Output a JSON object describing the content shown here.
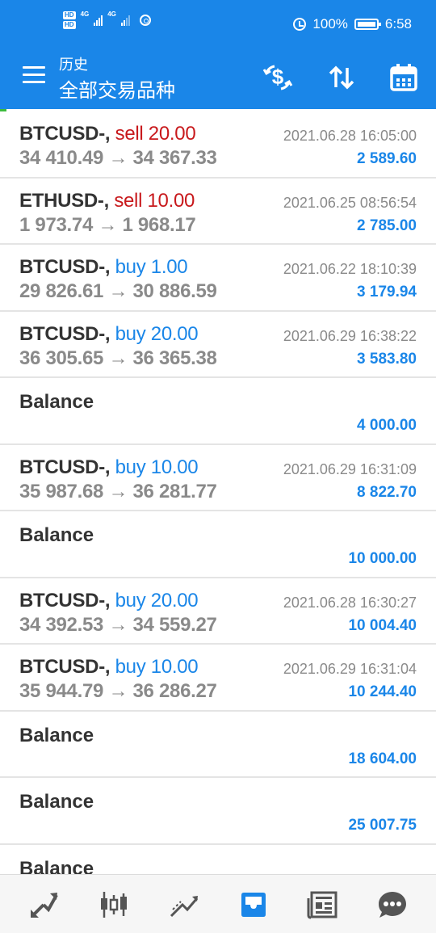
{
  "status_bar": {
    "hd1": "HD",
    "hd2": "HD",
    "sig1_label": "4G",
    "sig2_label": "4G",
    "battery_pct": "100%",
    "time": "6:58"
  },
  "app_bar": {
    "title": "历史",
    "subtitle": "全部交易品种",
    "icons": [
      "menu-icon",
      "dollar-swap-icon",
      "sort-icon",
      "calendar-icon"
    ]
  },
  "entries": [
    {
      "type": "trade",
      "symbol": "BTCUSD-,",
      "side": "sell",
      "volume": "20.00",
      "open": "34 410.49",
      "close": "34 367.33",
      "datetime": "2021.06.28 16:05:00",
      "profit": "2 589.60"
    },
    {
      "type": "trade",
      "symbol": "ETHUSD-,",
      "side": "sell",
      "volume": "10.00",
      "open": "1 973.74",
      "close": "1 968.17",
      "datetime": "2021.06.25 08:56:54",
      "profit": "2 785.00"
    },
    {
      "type": "trade",
      "symbol": "BTCUSD-,",
      "side": "buy",
      "volume": "1.00",
      "open": "29 826.61",
      "close": "30 886.59",
      "datetime": "2021.06.22 18:10:39",
      "profit": "3 179.94"
    },
    {
      "type": "trade",
      "symbol": "BTCUSD-,",
      "side": "buy",
      "volume": "20.00",
      "open": "36 305.65",
      "close": "36 365.38",
      "datetime": "2021.06.29 16:38:22",
      "profit": "3 583.80"
    },
    {
      "type": "balance",
      "label": "Balance",
      "amount": "4 000.00"
    },
    {
      "type": "trade",
      "symbol": "BTCUSD-,",
      "side": "buy",
      "volume": "10.00",
      "open": "35 987.68",
      "close": "36 281.77",
      "datetime": "2021.06.29 16:31:09",
      "profit": "8 822.70"
    },
    {
      "type": "balance",
      "label": "Balance",
      "amount": "10 000.00"
    },
    {
      "type": "trade",
      "symbol": "BTCUSD-,",
      "side": "buy",
      "volume": "20.00",
      "open": "34 392.53",
      "close": "34 559.27",
      "datetime": "2021.06.28 16:30:27",
      "profit": "10 004.40"
    },
    {
      "type": "trade",
      "symbol": "BTCUSD-,",
      "side": "buy",
      "volume": "10.00",
      "open": "35 944.79",
      "close": "36 286.27",
      "datetime": "2021.06.29 16:31:04",
      "profit": "10 244.40"
    },
    {
      "type": "balance",
      "label": "Balance",
      "amount": "18 604.00"
    },
    {
      "type": "balance",
      "label": "Balance",
      "amount": "25 007.75"
    },
    {
      "type": "balance",
      "label": "Balance",
      "amount": ""
    }
  ],
  "arrow_glyph": "→",
  "bottom_nav": {
    "items": [
      "quotes-icon",
      "chart-icon",
      "trade-icon",
      "history-icon",
      "news-icon",
      "chat-icon"
    ],
    "active": "history-icon"
  },
  "colors": {
    "primary": "#1a86e8",
    "sell": "#c8191c",
    "buy": "#1a86e8",
    "muted": "#8a8a8a",
    "icon": "#555555"
  }
}
